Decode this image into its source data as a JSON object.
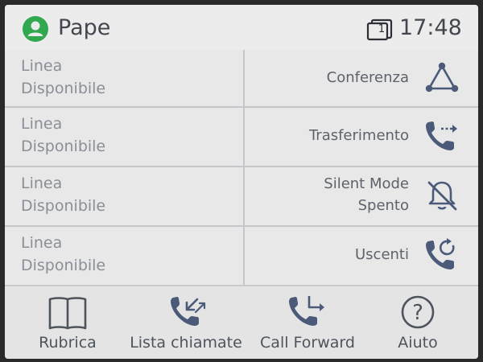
{
  "status_bar": {
    "user_name": "Pape",
    "line_badge": "1",
    "time": "17:48",
    "user_icon": "user-avatar-icon",
    "line_icon": "line-badge-icon"
  },
  "line_keys": [
    {
      "line1": "Linea",
      "line2": "Disponibile"
    },
    {
      "line1": "Linea",
      "line2": "Disponibile"
    },
    {
      "line1": "Linea",
      "line2": "Disponibile"
    },
    {
      "line1": "Linea",
      "line2": "Disponibile"
    }
  ],
  "feature_keys": [
    {
      "line1": "Conferenza",
      "line2": "",
      "icon": "conference-icon"
    },
    {
      "line1": "Trasferimento",
      "line2": "",
      "icon": "transfer-icon"
    },
    {
      "line1": "Silent Mode",
      "line2": "Spento",
      "icon": "bell-off-icon"
    },
    {
      "line1": "Uscenti",
      "line2": "",
      "icon": "outgoing-calls-icon"
    }
  ],
  "softkeys": [
    {
      "label": "Rubrica",
      "icon": "book-icon"
    },
    {
      "label": "Lista chiamate",
      "icon": "call-list-icon"
    },
    {
      "label": "Call Forward",
      "icon": "call-forward-icon"
    },
    {
      "label": "Aiuto",
      "icon": "help-icon"
    }
  ],
  "colors": {
    "accent_green": "#2fa84f",
    "icon_blue": "#4a5a78",
    "text_gray": "#8a8f97",
    "background": "#e6e6e6"
  }
}
